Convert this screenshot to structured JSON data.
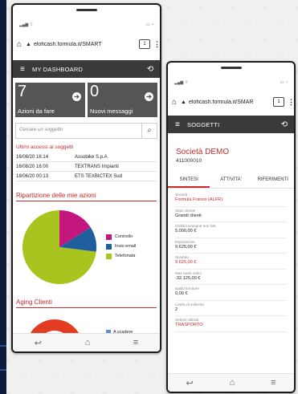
{
  "phone1": {
    "url": "eloficash.formula.it/SMART",
    "tabs_count": "1",
    "app_title": "MY DASHBOARD",
    "tiles": [
      {
        "number": "7",
        "label": "Azioni da fare"
      },
      {
        "number": "0",
        "label": "Nuovi messaggi"
      }
    ],
    "search_placeholder": "Cercare un soggetto",
    "recent_title": "Ultimi accessi ai soggetti",
    "recent": [
      {
        "date": "16/08/20 16:14",
        "name": "Assobike S.p.A"
      },
      {
        "date": "16/08/20 16:00",
        "name": "TEXTRANS Impianti"
      },
      {
        "date": "18/06/20 00:13",
        "name": "ETS TEXBICTEX Sud"
      }
    ],
    "actions_title": "Ripartizione delle mie azioni",
    "aging_title": "Aging Clienti",
    "aging_legend": "A scadere"
  },
  "chart_data": {
    "type": "pie",
    "title": "Ripartizione delle mie azioni",
    "categories": [
      "Controllo",
      "Invio email",
      "Telefonata"
    ],
    "values": [
      16,
      11,
      73
    ],
    "colors": [
      "#c4177e",
      "#1f5f9e",
      "#a9c31f"
    ]
  },
  "phone2": {
    "url": "eloficash.formula.it/SMAR",
    "tabs_count": "1",
    "app_title": "SOGGETTI",
    "company": "Società DEMO",
    "code": "411000010",
    "tabs": [
      "SINTESI",
      "ATTIVITA'",
      "RIFERIMENTI"
    ],
    "fields": [
      {
        "label": "Società",
        "value": "Formula France (ALFR)",
        "accent": true
      },
      {
        "label": "Stato cliente",
        "value": "Grandi clienti",
        "accent": false
      },
      {
        "label": "Ordini/consegne non fatt.",
        "value": "5.000,00 €",
        "accent": false
      },
      {
        "label": "Esposizione",
        "value": "9.625,00 €",
        "accent": false
      },
      {
        "label": "Scaduto",
        "value": "9.625,00 €",
        "accent": true
      },
      {
        "label": "Max ruolo ordini",
        "value": "-32.125,00 €",
        "accent": false
      },
      {
        "label": "Saldo fornitore",
        "value": "0,00 €",
        "accent": false
      },
      {
        "label": "Livello di sollecito",
        "value": "2",
        "accent": false
      },
      {
        "label": "Settore attività",
        "value": "TRASPORTO",
        "accent": true
      }
    ]
  },
  "colors": {
    "accent": "#c42b2b",
    "appbar": "#3a3a3a",
    "tile": "#555555"
  }
}
